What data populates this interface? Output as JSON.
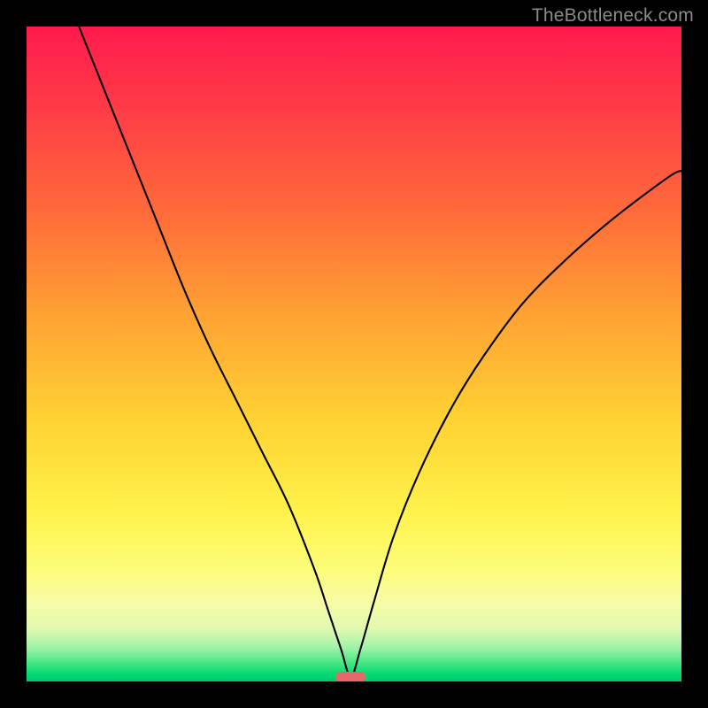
{
  "watermark": "TheBottleneck.com",
  "marker": {
    "color": "#e46a6a",
    "x_percent": 49.5,
    "y_percent": 99.3
  },
  "chart_data": {
    "type": "line",
    "title": "",
    "xlabel": "",
    "ylabel": "",
    "xlim": [
      0,
      100
    ],
    "ylim": [
      0,
      100
    ],
    "grid": false,
    "legend": false,
    "series": [
      {
        "name": "bottleneck-curve",
        "x": [
          8,
          12,
          16,
          20,
          24,
          28,
          32,
          36,
          40,
          44,
          46,
          48,
          49.5,
          51,
          53,
          56,
          60,
          65,
          70,
          76,
          83,
          90,
          98,
          100
        ],
        "y": [
          100,
          90,
          80,
          70,
          60,
          51,
          43,
          35,
          27,
          17,
          11,
          5,
          0.7,
          5,
          12,
          22,
          32,
          42,
          50,
          58,
          65,
          71,
          77,
          78
        ]
      }
    ],
    "annotations": [
      {
        "type": "marker",
        "shape": "pill",
        "x": 49.5,
        "y": 0.7,
        "color": "#e46a6a"
      }
    ]
  }
}
